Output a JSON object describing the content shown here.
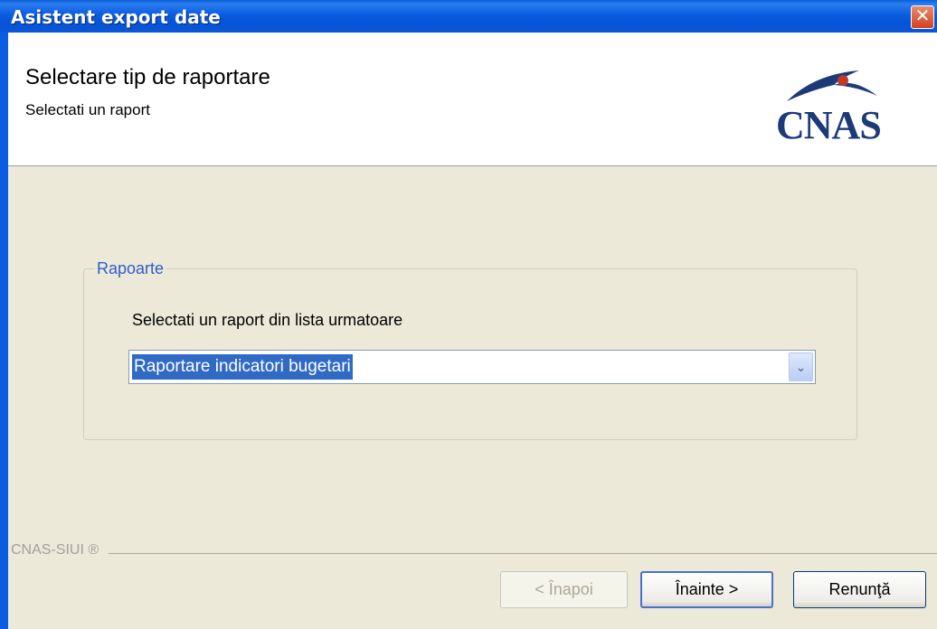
{
  "window": {
    "title": "Asistent export date"
  },
  "header": {
    "title": "Selectare tip de raportare",
    "subtitle": "Selectati un raport",
    "logo_text": "CNAS"
  },
  "group": {
    "legend": "Rapoarte",
    "prompt": "Selectati un raport din lista urmatoare",
    "selected_report": "Raportare indicatori bugetari"
  },
  "footer": {
    "label": "CNAS-SIUI ®"
  },
  "buttons": {
    "back": "< Înapoi",
    "next": "Înainte >",
    "cancel": "Renunţă"
  },
  "colors": {
    "titlebar": "#0a5ce0",
    "dialog_bg": "#ece9d8",
    "selection": "#316ac5",
    "legend": "#2f5dcd"
  }
}
